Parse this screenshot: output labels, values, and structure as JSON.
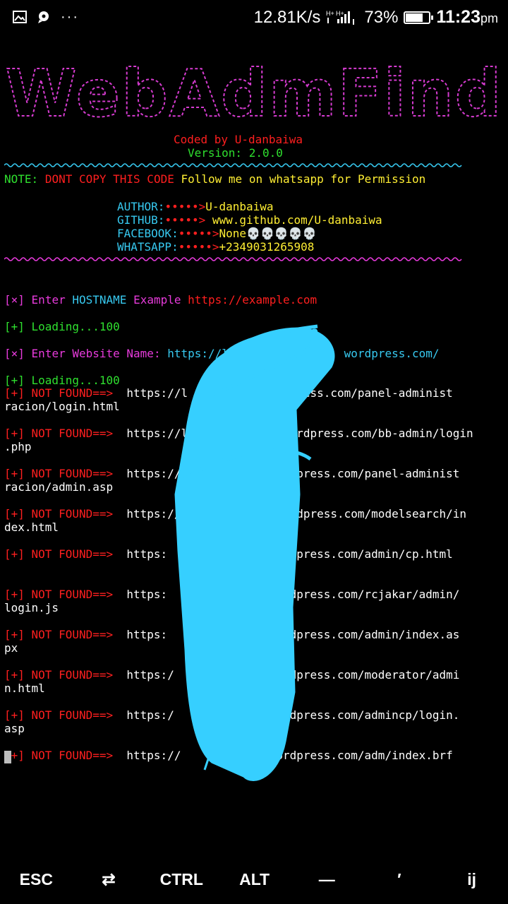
{
  "status_bar": {
    "speed": "12.81K/s",
    "network": "H+ H+",
    "battery_percent": "73%",
    "battery_level": 0.73,
    "time": "11:23",
    "ampm": "pm",
    "dots": "···"
  },
  "banner": {
    "title_art": "WebAdmFind",
    "coded_by": "Coded by U-danbaiwa",
    "version": "Version: 2.0.0"
  },
  "note": {
    "label": "NOTE:",
    "warning": "DONT COPY THIS CODE",
    "follow": "Follow me on whatsapp for Permission"
  },
  "info": [
    {
      "key": "AUTHOR:",
      "arrow": "•••••>",
      "value": "U-danbaiwa"
    },
    {
      "key": "GITHUB:",
      "arrow": "•••••>",
      "value": " www.github.com/U-danbaiwa"
    },
    {
      "key": "FACEBOOK:",
      "arrow": "•••••>",
      "value": "None💀💀💀💀💀"
    },
    {
      "key": "WHATSAPP:",
      "arrow": "•••••>",
      "value": "+2349031265908"
    }
  ],
  "prompts": {
    "hostname_prefix": "[×]",
    "hostname_enter": "Enter",
    "hostname_word": "HOSTNAME",
    "hostname_example": "Example",
    "hostname_url": "https://example.com",
    "loading1": "[+] Loading...100",
    "website_prefix": "[×]",
    "website_label": "Enter Website Name:",
    "website_value": "https://l                 wordpress.com/",
    "loading2": "[+] Loading...100"
  },
  "results": [
    {
      "tag": "[+]",
      "status": "NOT FOUND==>",
      "url1": "https://l               press.com/panel-administ",
      "url2": "racion/login.html"
    },
    {
      "tag": "[+]",
      "status": "NOT FOUND==>",
      "url1": "https://l              wordpress.com/bb-admin/login",
      "url2": ".php"
    },
    {
      "tag": "[+]",
      "status": "NOT FOUND==>",
      "url1": "https://                dpress.com/panel-administ",
      "url2": "racion/admin.asp"
    },
    {
      "tag": "[+]",
      "status": "NOT FOUND==>",
      "url1": "https://              rordpress.com/modelsearch/in",
      "url2": "dex.html"
    },
    {
      "tag": "[+]",
      "status": "NOT FOUND==>",
      "url1": "https:             g.wordpress.com/admin/cp.html",
      "url2": ""
    },
    {
      "tag": "[+]",
      "status": "NOT FOUND==>",
      "url1": "https:             g.wordpress.com/rcjakar/admin/",
      "url2": "login.js"
    },
    {
      "tag": "[+]",
      "status": "NOT FOUND==>",
      "url1": "https:              .wordpress.com/admin/index.as",
      "url2": "px"
    },
    {
      "tag": "[+]",
      "status": "NOT FOUND==>",
      "url1": "https:/            g.wordpress.com/moderator/admi",
      "url2": "n.html"
    },
    {
      "tag": "[+]",
      "status": "NOT FOUND==>",
      "url1": "https:/            g.wordpress.com/admincp/login.",
      "url2": "asp"
    },
    {
      "tag": "[+]",
      "status": "NOT FOUND==>",
      "url1": "https://           g.wordpress.com/adm/index.brf",
      "url2": ""
    }
  ],
  "extra_keys": [
    "ESC",
    "⇄",
    "CTRL",
    "ALT",
    "—",
    "′",
    "ij"
  ],
  "colors": {
    "red": "#ff1f1f",
    "green": "#2fe02f",
    "yellow": "#ffee33",
    "magenta": "#e83bdc",
    "cyan": "#37c9f0",
    "scribble": "#36cfff"
  }
}
